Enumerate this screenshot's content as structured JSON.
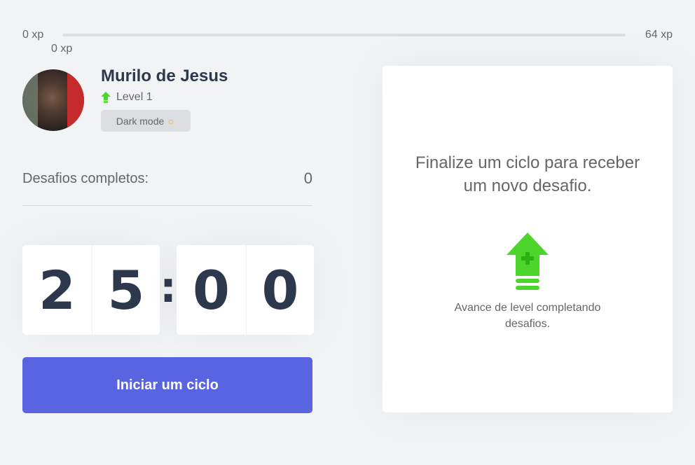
{
  "experience": {
    "min_label": "0 xp",
    "max_label": "64 xp",
    "current_label": "0 xp",
    "progress_fraction": 0,
    "bar_color": "#4cd62b"
  },
  "profile": {
    "name": "Murilo de Jesus",
    "level_label": "Level 1",
    "level_icon": "level-up-arrow-icon",
    "dark_mode_label": "Dark mode",
    "dark_mode_icon": "☼"
  },
  "stats": {
    "completed_label": "Desafios completos:",
    "completed_count": "0"
  },
  "countdown": {
    "minute_left": "2",
    "minute_right": "5",
    "separator": ":",
    "second_left": "0",
    "second_right": "0"
  },
  "actions": {
    "start_label": "Iniciar um ciclo",
    "start_color": "#5965e0"
  },
  "challenge": {
    "title": "Finalize um ciclo para receber um novo desafio.",
    "hint": "Avance de level completando desafios.",
    "icon": "level-up-icon",
    "accent": "#4cd62b"
  }
}
